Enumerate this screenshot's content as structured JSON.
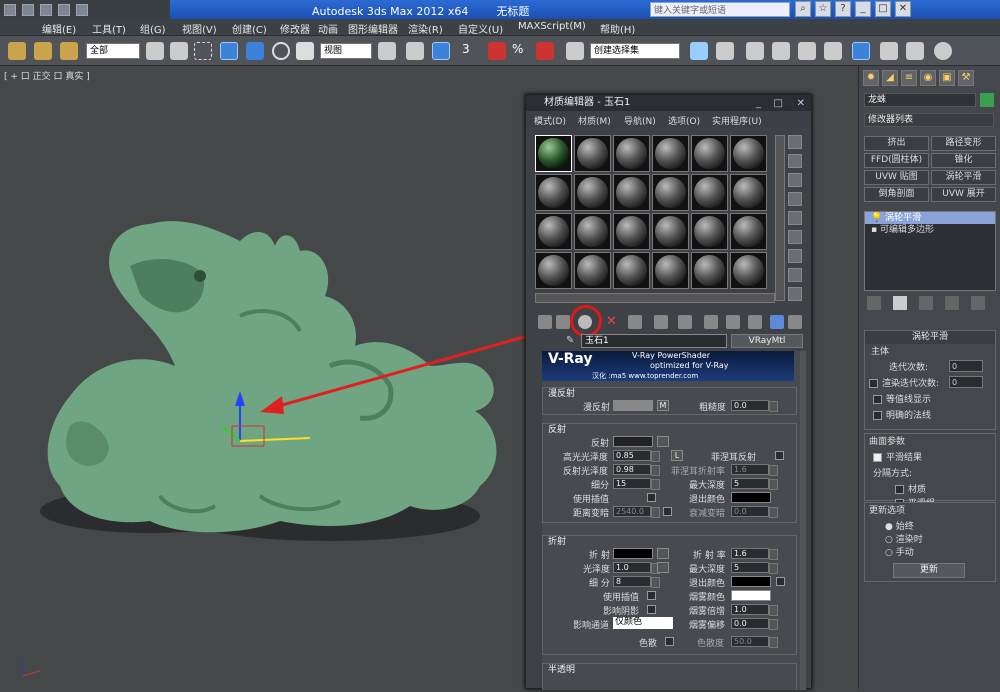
{
  "title": {
    "app": "Autodesk 3ds Max  2012 x64",
    "doc": "无标题",
    "search_placeholder": "键入关键字或短语"
  },
  "menu": [
    "编辑(E)",
    "工具(T)",
    "组(G)",
    "视图(V)",
    "创建(C)",
    "修改器",
    "动画",
    "图形编辑器",
    "渲染(R)",
    "自定义(U)",
    "MAXScript(M)",
    "帮助(H)"
  ],
  "toolbar": {
    "selection_filter": "全部",
    "ref_coord": "视图",
    "named_sel": "创建选择集",
    "snap_label": "3"
  },
  "viewport": {
    "label": "[ + 口 正交 口 真实 ]"
  },
  "command_panel": {
    "object_name": "龙蛛",
    "modifier_list": "修改器列表",
    "modifiers": [
      "挤出",
      "路径变形",
      "FFD(圆柱体)",
      "锥化",
      "UVW 贴图",
      "涡轮平滑",
      "倒角剖面",
      "UVW 展开"
    ],
    "stack": [
      "涡轮平滑",
      "可编辑多边形"
    ],
    "turbosmooth_title": "涡轮平滑",
    "main_label": "主体",
    "iterations_label": "迭代次数:",
    "iterations": "0",
    "render_iters_label": "渲染迭代次数:",
    "render_iters": "0",
    "isoline": "等值线显示",
    "explicit_normals": "明确的法线",
    "surface_title": "曲面参数",
    "smooth_result": "平滑结果",
    "sep_by": "分隔方式:",
    "material": "材质",
    "smooth_groups": "平滑组",
    "update_title": "更新选项",
    "always": "始终",
    "when_render": "渲染时",
    "manual": "手动",
    "update_btn": "更新"
  },
  "material_editor": {
    "title": "材质编辑器 - 玉石1",
    "menus": [
      "模式(D)",
      "材质(M)",
      "导航(N)",
      "选项(O)",
      "实用程序(U)"
    ],
    "mat_name": "玉石1",
    "mat_type": "VRayMtl",
    "banner_line1": "V-Ray PowerShader",
    "banner_line2": "optimized for V-Ray",
    "banner_line3": "汉化 :ma5  www.toprender.com",
    "diffuse_sec": "漫反射",
    "diffuse": "漫反射",
    "diffuse_m": "M",
    "roughness": "粗糙度",
    "roughness_val": "0.0",
    "reflect_sec": "反射",
    "reflect": "反射",
    "hilight_gloss": "高光光泽度",
    "hilight_val": "0.85",
    "lock": "L",
    "fresnel": "菲涅耳反射",
    "refl_gloss": "反射光泽度",
    "refl_gloss_val": "0.98",
    "fresnel_ior": "菲涅耳折射率",
    "fresnel_ior_val": "1.6",
    "subdivs": "细分",
    "subdivs_val": "15",
    "max_depth": "最大深度",
    "max_depth_val": "5",
    "use_interp": "使用插值",
    "exit_color": "退出颜色",
    "dim_dist": "距离变暗",
    "dim_dist_val": "2540.0",
    "dim_falloff": "衰减变暗",
    "dim_falloff_val": "0.0",
    "refract_sec": "折射",
    "refract": "折 射",
    "ior": "折 射 率",
    "ior_val": "1.6",
    "gloss": "光泽度",
    "gloss_val": "1.0",
    "r_max_depth": "最大深度",
    "r_max_depth_val": "5",
    "r_subdivs": "细 分",
    "r_subdivs_val": "8",
    "r_exit_color": "退出颜色",
    "r_use_interp": "使用插值",
    "fog_color": "烟雾颜色",
    "affect_shadows": "影响阴影",
    "fog_mult": "烟雾倍增",
    "fog_mult_val": "1.0",
    "affect_channels": "影响通道",
    "affect_channels_val": "仅颜色",
    "fog_bias": "烟雾偏移",
    "fog_bias_val": "0.0",
    "dispersion": "色散",
    "abbe": "色散度",
    "abbe_val": "50.0",
    "translucent_sec": "半透明"
  },
  "colors": {
    "accent": "#2c6bd4",
    "model": "#6fa583",
    "arrow": "#e02020"
  }
}
